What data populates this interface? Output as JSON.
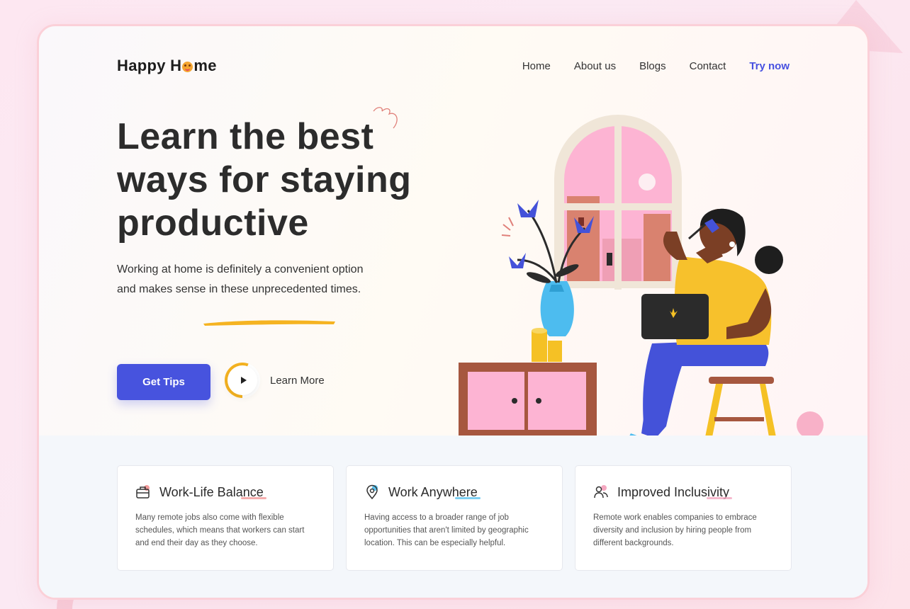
{
  "brand": {
    "name_prefix": "Happy H",
    "name_suffix": "me"
  },
  "nav": {
    "items": [
      "Home",
      "About us",
      "Blogs",
      "Contact"
    ],
    "cta": "Try now"
  },
  "hero": {
    "title_lines": [
      "Learn the best",
      "ways for staying",
      "productive"
    ],
    "description": "Working at home is definitely a convenient option and makes sense in these unprecedented times.",
    "primary_button": "Get Tips",
    "secondary_button": "Learn More"
  },
  "features": [
    {
      "icon": "briefcase-icon",
      "title": "Work-Life Balance",
      "text": "Many remote jobs also come with flexible schedules, which means that workers can start and end their day as they choose.",
      "accent": "#f29a9a"
    },
    {
      "icon": "location-pin-icon",
      "title": "Work Anywhere",
      "text": "Having access to a broader range of job opportunities that aren't limited by geographic location. This can be especially helpful.",
      "accent": "#5cc3ef"
    },
    {
      "icon": "users-icon",
      "title": "Improved Inclusivity",
      "text": "Remote work enables companies to embrace diversity and inclusion by hiring people from different backgrounds.",
      "accent": "#f4a7c0"
    }
  ],
  "colors": {
    "primary": "#4753de",
    "accent_yellow": "#f5b321",
    "frame_border": "#fbd0d8"
  }
}
